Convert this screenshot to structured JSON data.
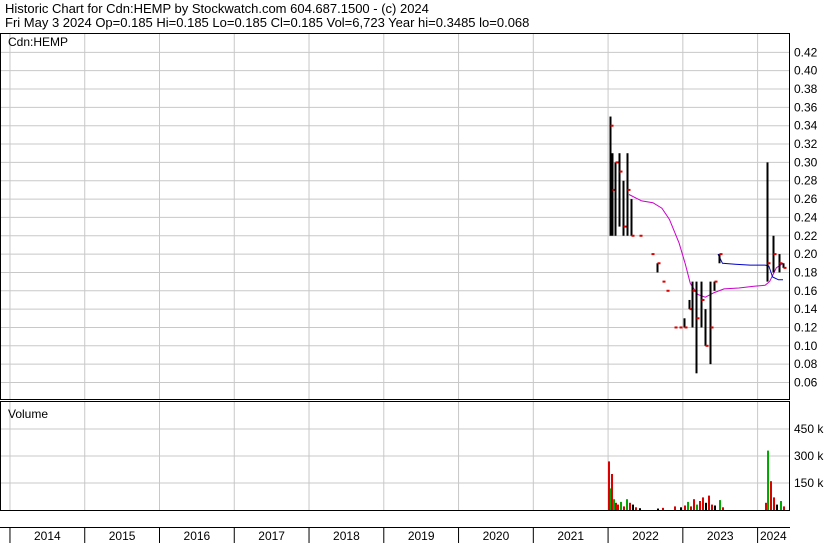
{
  "header": {
    "line1": "Historic Chart for Cdn:HEMP by Stockwatch.com 604.687.1500 - (c) 2024",
    "line2": "Fri May  3 2024   Op=0.185  Hi=0.185  Lo=0.185  Cl=0.185  Vol=6,723  Year hi=0.3485  lo=0.068"
  },
  "chart_data": [
    {
      "type": "candlestick",
      "title": "Cdn:HEMP",
      "y_ticks": [
        "0.42",
        "0.40",
        "0.38",
        "0.36",
        "0.34",
        "0.32",
        "0.30",
        "0.28",
        "0.26",
        "0.24",
        "0.22",
        "0.20",
        "0.18",
        "0.16",
        "0.14",
        "0.12",
        "0.10",
        "0.08",
        "0.06"
      ],
      "ylim": [
        0.042,
        0.44
      ],
      "x_ticks": [
        "2014",
        "2015",
        "2016",
        "2017",
        "2018",
        "2019",
        "2020",
        "2021",
        "2022",
        "2023",
        "2024"
      ],
      "xlim": [
        2013.88,
        2024.42
      ],
      "grid": true,
      "colors": {
        "bar": "#000000",
        "close_tick": "#dd0000",
        "ma_long": "#cc00cc",
        "ma_short": "#0000cc",
        "grid": "#c8c8c8"
      },
      "bars": [
        {
          "x": 2022.02,
          "h": 0.35,
          "l": 0.22,
          "c": 0.34
        },
        {
          "x": 2022.05,
          "h": 0.31,
          "l": 0.22,
          "c": 0.27
        },
        {
          "x": 2022.09,
          "h": 0.3,
          "l": 0.22,
          "c": 0.3
        },
        {
          "x": 2022.14,
          "h": 0.31,
          "l": 0.23,
          "c": 0.29
        },
        {
          "x": 2022.2,
          "h": 0.28,
          "l": 0.22,
          "c": 0.23
        },
        {
          "x": 2022.25,
          "h": 0.31,
          "l": 0.22,
          "c": 0.27
        },
        {
          "x": 2022.3,
          "h": 0.26,
          "l": 0.22,
          "c": 0.22
        },
        {
          "x": 2022.42,
          "h": 0.22,
          "l": 0.22,
          "c": 0.22
        },
        {
          "x": 2022.58,
          "h": 0.2,
          "l": 0.2,
          "c": 0.2
        },
        {
          "x": 2022.65,
          "h": 0.19,
          "l": 0.18,
          "c": 0.19
        },
        {
          "x": 2022.72,
          "h": 0.17,
          "l": 0.17,
          "c": 0.17
        },
        {
          "x": 2022.78,
          "h": 0.16,
          "l": 0.16,
          "c": 0.16
        },
        {
          "x": 2022.88,
          "h": 0.12,
          "l": 0.12,
          "c": 0.12
        },
        {
          "x": 2022.95,
          "h": 0.12,
          "l": 0.12,
          "c": 0.12
        },
        {
          "x": 2023.02,
          "h": 0.13,
          "l": 0.12,
          "c": 0.12
        },
        {
          "x": 2023.08,
          "h": 0.15,
          "l": 0.14,
          "c": 0.14
        },
        {
          "x": 2023.12,
          "h": 0.17,
          "l": 0.12,
          "c": 0.16
        },
        {
          "x": 2023.18,
          "h": 0.17,
          "l": 0.07,
          "c": 0.13
        },
        {
          "x": 2023.24,
          "h": 0.17,
          "l": 0.12,
          "c": 0.15
        },
        {
          "x": 2023.3,
          "h": 0.14,
          "l": 0.1,
          "c": 0.1
        },
        {
          "x": 2023.36,
          "h": 0.17,
          "l": 0.08,
          "c": 0.12
        },
        {
          "x": 2023.42,
          "h": 0.17,
          "l": 0.16,
          "c": 0.17
        },
        {
          "x": 2023.48,
          "h": 0.2,
          "l": 0.19,
          "c": 0.2
        },
        {
          "x": 2024.12,
          "h": 0.3,
          "l": 0.17,
          "c": 0.19
        },
        {
          "x": 2024.2,
          "h": 0.22,
          "l": 0.18,
          "c": 0.2
        },
        {
          "x": 2024.28,
          "h": 0.2,
          "l": 0.18,
          "c": 0.19
        },
        {
          "x": 2024.34,
          "h": 0.19,
          "l": 0.185,
          "c": 0.185
        }
      ],
      "ma_long": [
        [
          2022.28,
          0.265
        ],
        [
          2022.45,
          0.258
        ],
        [
          2022.6,
          0.256
        ],
        [
          2022.72,
          0.25
        ],
        [
          2022.82,
          0.238
        ],
        [
          2022.88,
          0.226
        ],
        [
          2022.95,
          0.212
        ],
        [
          2023.03,
          0.19
        ],
        [
          2023.1,
          0.168
        ],
        [
          2023.2,
          0.156
        ],
        [
          2023.3,
          0.153
        ],
        [
          2023.42,
          0.158
        ],
        [
          2023.55,
          0.162
        ],
        [
          2023.75,
          0.163
        ],
        [
          2023.95,
          0.165
        ],
        [
          2024.1,
          0.166
        ],
        [
          2024.16,
          0.17
        ],
        [
          2024.25,
          0.185
        ],
        [
          2024.34,
          0.19
        ]
      ],
      "ma_short": [
        [
          2023.47,
          0.2
        ],
        [
          2023.53,
          0.19
        ],
        [
          2023.7,
          0.189
        ],
        [
          2023.9,
          0.188
        ],
        [
          2024.1,
          0.188
        ],
        [
          2024.15,
          0.187
        ],
        [
          2024.2,
          0.175
        ],
        [
          2024.28,
          0.172
        ],
        [
          2024.34,
          0.172
        ]
      ]
    },
    {
      "type": "bar",
      "title": "Volume",
      "y_ticks": [
        "450 k",
        "300 k",
        "150 k"
      ],
      "ylim": [
        0,
        600000
      ],
      "xlim": [
        2013.88,
        2024.42
      ],
      "colors": {
        "up": "#00aa00",
        "down": "#dd0000",
        "flat": "#000000"
      },
      "bars": [
        {
          "x": 2022.0,
          "v": 270000,
          "c": "down"
        },
        {
          "x": 2022.02,
          "v": 120000,
          "c": "up"
        },
        {
          "x": 2022.04,
          "v": 200000,
          "c": "down"
        },
        {
          "x": 2022.06,
          "v": 60000,
          "c": "up"
        },
        {
          "x": 2022.09,
          "v": 40000,
          "c": "down"
        },
        {
          "x": 2022.12,
          "v": 30000,
          "c": "down"
        },
        {
          "x": 2022.16,
          "v": 45000,
          "c": "up"
        },
        {
          "x": 2022.2,
          "v": 20000,
          "c": "down"
        },
        {
          "x": 2022.24,
          "v": 60000,
          "c": "up"
        },
        {
          "x": 2022.28,
          "v": 40000,
          "c": "down"
        },
        {
          "x": 2022.32,
          "v": 30000,
          "c": "flat"
        },
        {
          "x": 2022.36,
          "v": 15000,
          "c": "down"
        },
        {
          "x": 2022.42,
          "v": 10000,
          "c": "flat"
        },
        {
          "x": 2022.66,
          "v": 8000,
          "c": "flat"
        },
        {
          "x": 2022.72,
          "v": 12000,
          "c": "down"
        },
        {
          "x": 2022.88,
          "v": 20000,
          "c": "down"
        },
        {
          "x": 2022.96,
          "v": 15000,
          "c": "flat"
        },
        {
          "x": 2023.02,
          "v": 25000,
          "c": "down"
        },
        {
          "x": 2023.06,
          "v": 45000,
          "c": "up"
        },
        {
          "x": 2023.1,
          "v": 20000,
          "c": "down"
        },
        {
          "x": 2023.14,
          "v": 60000,
          "c": "down"
        },
        {
          "x": 2023.18,
          "v": 30000,
          "c": "up"
        },
        {
          "x": 2023.22,
          "v": 50000,
          "c": "down"
        },
        {
          "x": 2023.26,
          "v": 70000,
          "c": "down"
        },
        {
          "x": 2023.3,
          "v": 40000,
          "c": "flat"
        },
        {
          "x": 2023.34,
          "v": 80000,
          "c": "down"
        },
        {
          "x": 2023.38,
          "v": 30000,
          "c": "down"
        },
        {
          "x": 2023.42,
          "v": 25000,
          "c": "flat"
        },
        {
          "x": 2023.48,
          "v": 55000,
          "c": "up"
        },
        {
          "x": 2023.52,
          "v": 15000,
          "c": "down"
        },
        {
          "x": 2024.1,
          "v": 40000,
          "c": "down"
        },
        {
          "x": 2024.13,
          "v": 330000,
          "c": "up"
        },
        {
          "x": 2024.16,
          "v": 160000,
          "c": "down"
        },
        {
          "x": 2024.2,
          "v": 70000,
          "c": "down"
        },
        {
          "x": 2024.24,
          "v": 30000,
          "c": "flat"
        },
        {
          "x": 2024.3,
          "v": 50000,
          "c": "up"
        },
        {
          "x": 2024.34,
          "v": 20000,
          "c": "down"
        }
      ]
    }
  ]
}
